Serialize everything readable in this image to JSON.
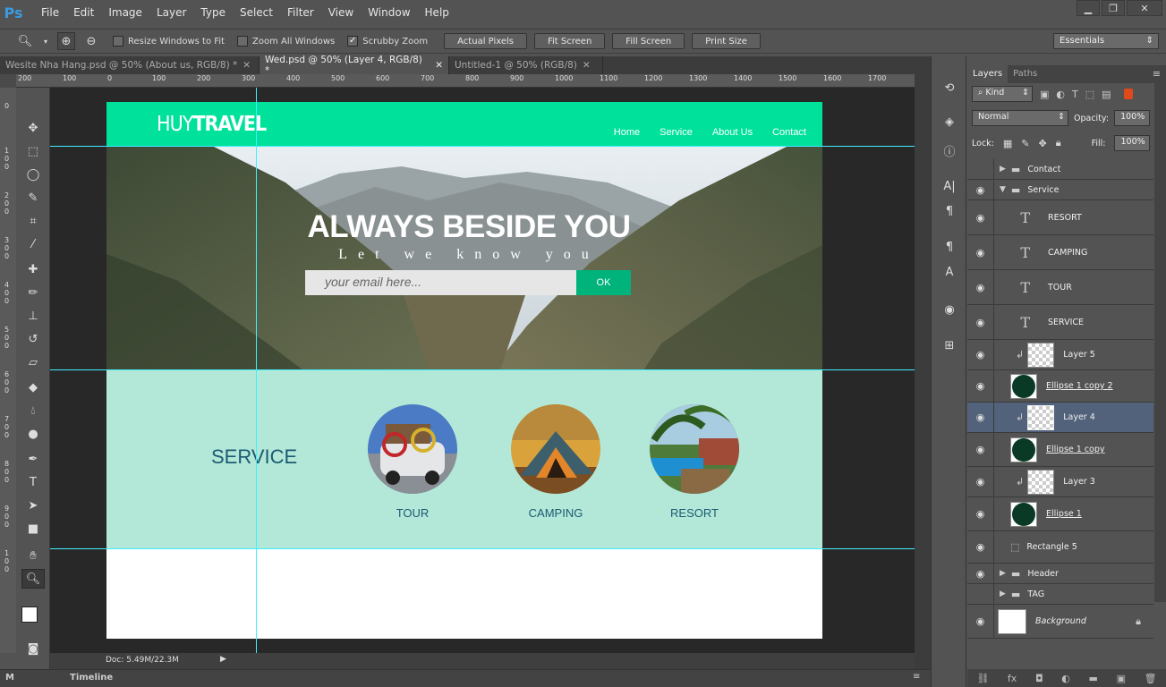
{
  "app": {
    "logo": "Ps",
    "menus": [
      "File",
      "Edit",
      "Image",
      "Layer",
      "Type",
      "Select",
      "Filter",
      "View",
      "Window",
      "Help"
    ]
  },
  "options_bar": {
    "checkboxes": [
      {
        "label": "Resize Windows to Fit",
        "checked": false
      },
      {
        "label": "Zoom All Windows",
        "checked": false
      },
      {
        "label": "Scrubby Zoom",
        "checked": true
      }
    ],
    "buttons": [
      "Actual Pixels",
      "Fit Screen",
      "Fill Screen",
      "Print Size"
    ],
    "workspace": "Essentials"
  },
  "doc_tabs": [
    {
      "label": "Wesite Nha Hang.psd @ 50% (About us, RGB/8) *",
      "active": false
    },
    {
      "label": "Wed.psd @ 50% (Layer 4, RGB/8) *",
      "active": true
    },
    {
      "label": "Untitled-1 @ 50% (RGB/8)",
      "active": false
    }
  ],
  "ruler": {
    "top": [
      "200",
      "100",
      "0",
      "100",
      "200",
      "300",
      "400",
      "500",
      "600",
      "700",
      "800",
      "900",
      "1000",
      "1100",
      "1200",
      "1300",
      "1400",
      "1500",
      "1600",
      "1700"
    ],
    "left": [
      "0",
      "1\n0\n0",
      "2\n0\n0",
      "3\n0\n0",
      "4\n0\n0",
      "5\n0\n0",
      "6\n0\n0",
      "7\n0\n0",
      "8\n0\n0",
      "9\n0\n0",
      "1\n0\n0"
    ]
  },
  "status": {
    "doc": "Doc: 5.49M/22.3M"
  },
  "bottom_tabs": [
    "M",
    "Timeline"
  ],
  "layers_panel": {
    "tabs": [
      "Layers",
      "Paths"
    ],
    "filter": "Kind",
    "blend_mode": "Normal",
    "opacity_label": "Opacity:",
    "opacity": "100%",
    "lock_label": "Lock:",
    "fill_label": "Fill:",
    "fill": "100%",
    "layers": [
      {
        "name": "Contact",
        "type": "group",
        "visible": false,
        "expanded": false
      },
      {
        "name": "Service",
        "type": "group",
        "visible": true,
        "expanded": true
      },
      {
        "name": "RESORT",
        "type": "text",
        "visible": true
      },
      {
        "name": "CAMPING",
        "type": "text",
        "visible": true
      },
      {
        "name": "TOUR",
        "type": "text",
        "visible": true
      },
      {
        "name": "SERVICE",
        "type": "text",
        "visible": true
      },
      {
        "name": "Layer 5",
        "type": "clipped",
        "visible": true
      },
      {
        "name": "Ellipse 1 copy 2",
        "type": "shape",
        "visible": true
      },
      {
        "name": "Layer 4",
        "type": "clipped",
        "visible": true,
        "active": true
      },
      {
        "name": "Ellipse 1 copy",
        "type": "shape",
        "visible": true
      },
      {
        "name": "Layer 3",
        "type": "clipped",
        "visible": true
      },
      {
        "name": "Ellipse 1",
        "type": "shape",
        "visible": true
      },
      {
        "name": "Rectangle 5",
        "type": "rect",
        "visible": true
      },
      {
        "name": "Header",
        "type": "group",
        "visible": true,
        "expanded": false
      },
      {
        "name": "TAG",
        "type": "group",
        "visible": false,
        "expanded": false
      },
      {
        "name": "Background",
        "type": "background",
        "visible": true
      }
    ]
  },
  "design": {
    "logo_light": "HUY",
    "logo_bold": "TRAVEL",
    "nav": [
      "Home",
      "Service",
      "About Us",
      "Contact"
    ],
    "hero_title": "ALWAYS BESIDE YOU",
    "hero_subtitle": "Let we know you",
    "email_placeholder": "your email here...",
    "ok_label": "OK",
    "service_title": "SERVICE",
    "services": [
      "TOUR",
      "CAMPING",
      "RESORT"
    ],
    "colors": {
      "header": "#00e19b",
      "service_bg": "#b3e8d8",
      "ok": "#00b37a",
      "service_text": "#1b5a72"
    }
  }
}
